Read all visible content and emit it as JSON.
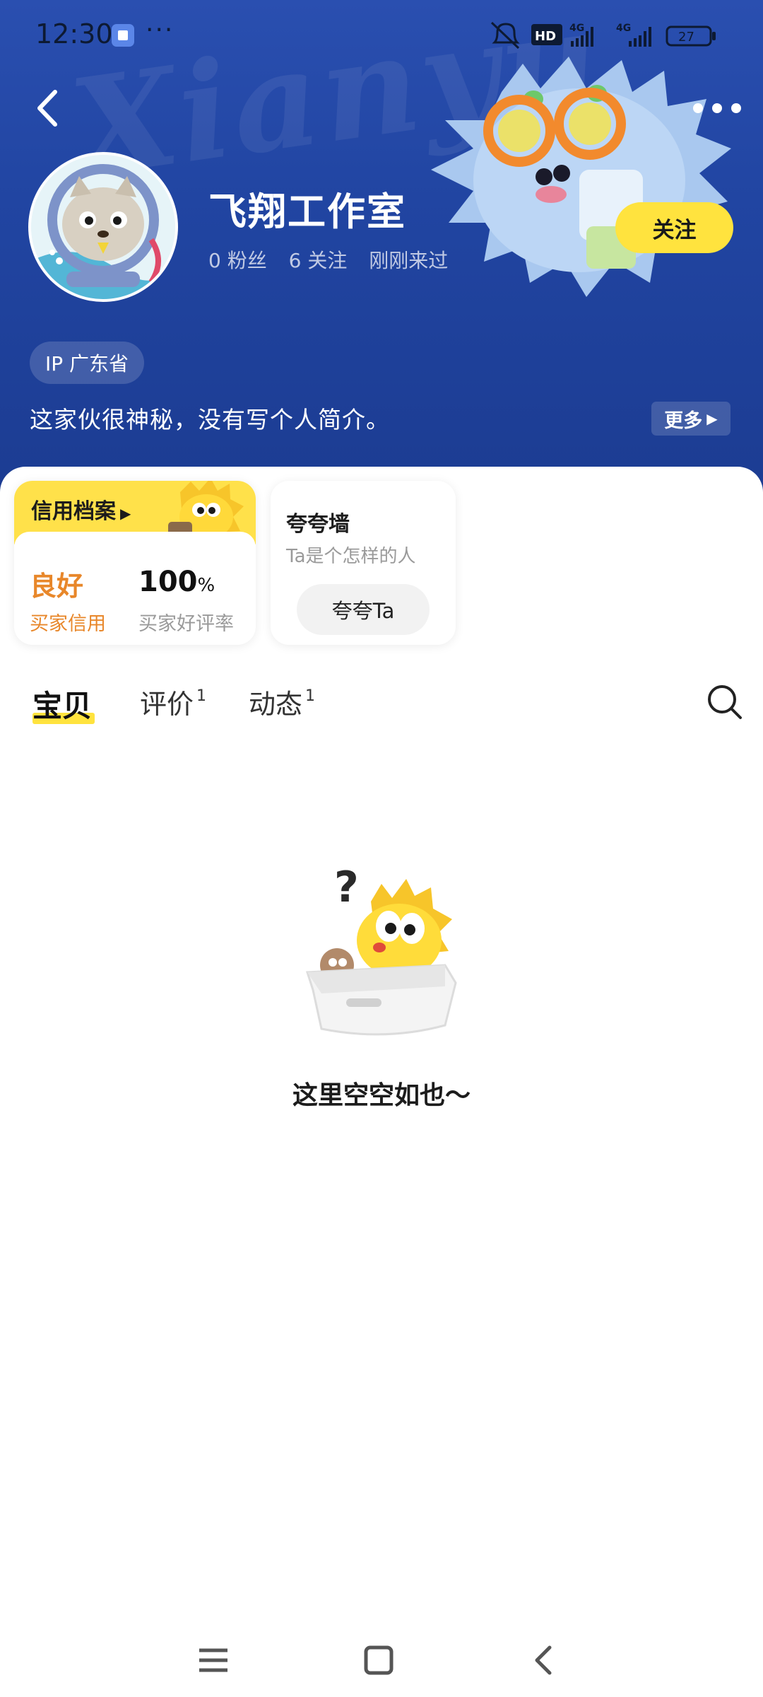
{
  "status_bar": {
    "time": "12:30",
    "dots": "···",
    "battery": "27",
    "network_label_1": "4G",
    "network_label_2": "4G",
    "hd_label": "HD"
  },
  "header": {
    "watermark": "Xianyu",
    "shop_name": "飞翔工作室",
    "stats": {
      "fans": "0 粉丝",
      "following": "6 关注",
      "last_seen": "刚刚来过"
    },
    "follow_button": "关注",
    "ip_location": "IP 广东省",
    "bio": "这家伙很神秘，没有写个人简介。",
    "more_button": "更多"
  },
  "credit_card": {
    "title": "信用档案",
    "level": "良好",
    "level_label": "买家信用",
    "rate": "100",
    "rate_unit": "%",
    "rate_label": "买家好评率"
  },
  "praise_card": {
    "title": "夸夸墙",
    "subtitle": "Ta是个怎样的人",
    "button": "夸夸Ta"
  },
  "tabs": [
    {
      "label": "宝贝",
      "badge": ""
    },
    {
      "label": "评价",
      "badge": "1"
    },
    {
      "label": "动态",
      "badge": "1"
    }
  ],
  "empty_state": {
    "text": "这里空空如也～"
  },
  "colors": {
    "header_blue": "#2145a2",
    "accent_yellow": "#ffe33e",
    "credit_orange": "#e8872a"
  },
  "icons": [
    "back-icon",
    "more-dots-icon",
    "search-icon",
    "menu-icon",
    "home-icon",
    "nav-back-icon"
  ]
}
